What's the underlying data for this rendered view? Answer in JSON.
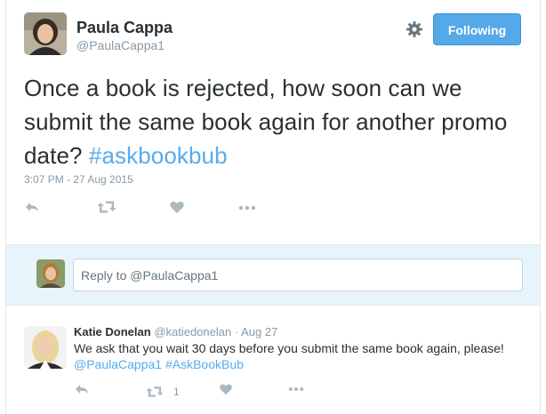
{
  "tweet": {
    "author_name": "Paula Cappa",
    "author_handle": "@PaulaCappa1",
    "follow_label": "Following",
    "text_plain": "Once a book is rejected, how soon can we submit the same book again for another promo date? ",
    "hashtag": "#askbookbub",
    "timestamp": "3:07 PM - 27 Aug 2015"
  },
  "reply_box": {
    "placeholder": "Reply to @PaulaCappa1"
  },
  "reply": {
    "author_name": "Katie Donelan",
    "author_handle": "@katiedonelan",
    "separator": " · ",
    "date": "Aug 27",
    "text": "We ask that you wait 30 days before you submit the same book again, please!",
    "mention": "@PaulaCappa1",
    "hashtag": "#AskBookBub",
    "retweet_count": "1"
  },
  "colors": {
    "link": "#55acee",
    "follow_button": "#55a9e8",
    "icon_gray": "#aab8c2",
    "reply_bg": "#e8f4fb"
  },
  "icons": [
    "gear-icon",
    "reply-icon",
    "retweet-icon",
    "like-icon",
    "more-icon"
  ]
}
